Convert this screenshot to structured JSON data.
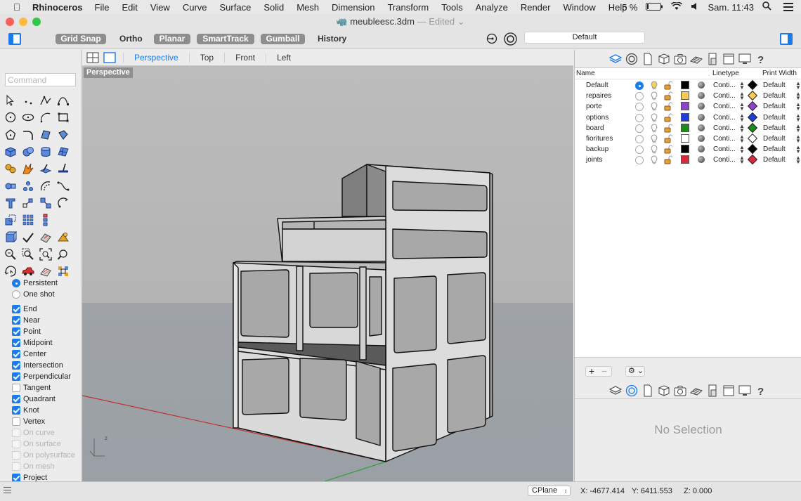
{
  "menubar": {
    "app": "Rhinoceros",
    "menus": [
      "File",
      "Edit",
      "View",
      "Curve",
      "Surface",
      "Solid",
      "Mesh",
      "Dimension",
      "Transform",
      "Tools",
      "Analyze",
      "Render",
      "Window",
      "Help"
    ],
    "battery": "5 %",
    "clock": "Sam. 11:43"
  },
  "window": {
    "title": "meubleesc.3dm",
    "edited": "— Edited",
    "colors": {
      "close": "#fc605c",
      "minimize": "#fdbc40",
      "zoom": "#34c84a",
      "accent": "#1b7be8"
    }
  },
  "toolbar": {
    "grid_snap": "Grid Snap",
    "ortho": "Ortho",
    "planar": "Planar",
    "smarttrack": "SmartTrack",
    "gumball": "Gumball",
    "history": "History",
    "current_layer": "Default"
  },
  "command": {
    "placeholder": "Command"
  },
  "osnap": {
    "mode": [
      {
        "label": "Persistent",
        "selected": true
      },
      {
        "label": "One shot",
        "selected": false
      }
    ],
    "snaps": [
      {
        "label": "End",
        "checked": true,
        "enabled": true
      },
      {
        "label": "Near",
        "checked": true,
        "enabled": true
      },
      {
        "label": "Point",
        "checked": true,
        "enabled": true
      },
      {
        "label": "Midpoint",
        "checked": true,
        "enabled": true
      },
      {
        "label": "Center",
        "checked": true,
        "enabled": true
      },
      {
        "label": "Intersection",
        "checked": true,
        "enabled": true
      },
      {
        "label": "Perpendicular",
        "checked": true,
        "enabled": true
      },
      {
        "label": "Tangent",
        "checked": false,
        "enabled": true
      },
      {
        "label": "Quadrant",
        "checked": true,
        "enabled": true
      },
      {
        "label": "Knot",
        "checked": true,
        "enabled": true
      },
      {
        "label": "Vertex",
        "checked": false,
        "enabled": true
      },
      {
        "label": "On curve",
        "checked": false,
        "enabled": false
      },
      {
        "label": "On surface",
        "checked": false,
        "enabled": false
      },
      {
        "label": "On polysurface",
        "checked": false,
        "enabled": false
      },
      {
        "label": "On mesh",
        "checked": false,
        "enabled": false
      },
      {
        "label": "Project",
        "checked": true,
        "enabled": true
      }
    ]
  },
  "viewports": {
    "tabs": [
      "Perspective",
      "Top",
      "Front",
      "Left"
    ],
    "active": "Perspective",
    "label": "Perspective"
  },
  "layers": {
    "headers": {
      "name": "Name",
      "linetype": "Linetype",
      "print_width": "Print Width"
    },
    "rows": [
      {
        "name": "Default",
        "current": true,
        "color": "#000000",
        "linetype": "Conti...",
        "print_width": "Default"
      },
      {
        "name": "repaires",
        "current": false,
        "color": "#f5c85a",
        "linetype": "Conti...",
        "print_width": "Default"
      },
      {
        "name": "porte",
        "current": false,
        "color": "#8e44c8",
        "linetype": "Conti...",
        "print_width": "Default"
      },
      {
        "name": "options",
        "current": false,
        "color": "#1f3fd8",
        "linetype": "Conti...",
        "print_width": "Default"
      },
      {
        "name": "board",
        "current": false,
        "color": "#1c8a1c",
        "linetype": "Conti...",
        "print_width": "Default"
      },
      {
        "name": "fioritures",
        "current": false,
        "color": "#ffffff",
        "linetype": "Conti...",
        "print_width": "Default"
      },
      {
        "name": "backup",
        "current": false,
        "color": "#000000",
        "linetype": "Conti...",
        "print_width": "Default"
      },
      {
        "name": "joints",
        "current": false,
        "color": "#d8283a",
        "linetype": "Conti...",
        "print_width": "Default"
      }
    ]
  },
  "properties": {
    "empty_text": "No Selection"
  },
  "status": {
    "cplane": "CPlane",
    "x": "X: -4677.414",
    "y": "Y: 6411.553",
    "z": "Z: 0.000"
  }
}
